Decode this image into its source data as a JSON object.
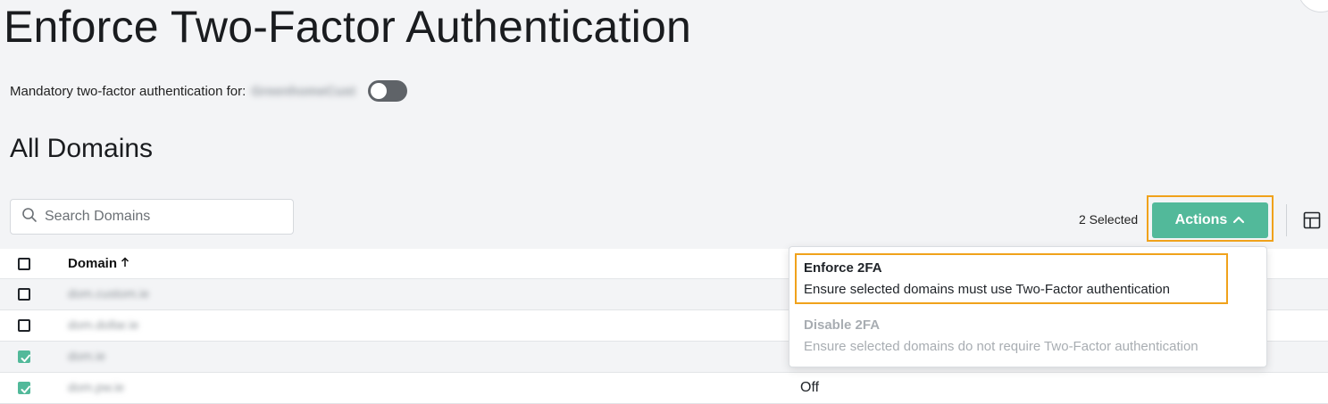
{
  "page": {
    "title": "Enforce Two-Factor Authentication"
  },
  "mandatory": {
    "label": "Mandatory two-factor authentication for:",
    "org_name": "GreenhomeCust",
    "enabled": false
  },
  "section": {
    "title": "All Domains"
  },
  "search": {
    "placeholder": "Search Domains",
    "value": "",
    "icon": "search-icon"
  },
  "toolbar": {
    "selected_count": "2 Selected",
    "actions_label": "Actions",
    "actions_icon": "chevron-up-icon",
    "columns_icon": "columns-icon",
    "accent_color": "#52b99a",
    "highlight_color": "#f0a21b"
  },
  "table": {
    "header": {
      "domain_label": "Domain",
      "sort_icon": "arrow-up-icon"
    },
    "rows": [
      {
        "domain": "dom.custom.ie",
        "checked": false,
        "status": ""
      },
      {
        "domain": "dom.dollar.ie",
        "checked": false,
        "status": ""
      },
      {
        "domain": "dom.ie",
        "checked": true,
        "status": ""
      },
      {
        "domain": "dom.pw.ie",
        "checked": true,
        "status": "Off"
      }
    ]
  },
  "actions_menu": {
    "items": [
      {
        "title": "Enforce 2FA",
        "description": "Ensure selected domains must use Two-Factor authentication",
        "enabled": true
      },
      {
        "title": "Disable 2FA",
        "description": "Ensure selected domains do not require Two-Factor authentication",
        "enabled": false
      }
    ]
  }
}
